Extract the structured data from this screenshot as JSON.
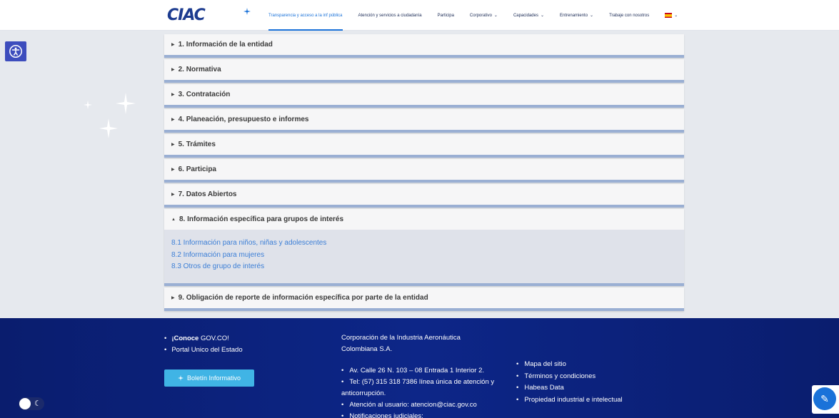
{
  "header": {
    "logo_text": "CIAC",
    "nav": [
      {
        "label": "Transparencia y acceso a la inf pública",
        "active": true,
        "dropdown": false
      },
      {
        "label": "Atención y servicios a ciudadanía",
        "active": false,
        "dropdown": false
      },
      {
        "label": "Participa",
        "active": false,
        "dropdown": false
      },
      {
        "label": "Corporativo",
        "active": false,
        "dropdown": true
      },
      {
        "label": "Capacidades",
        "active": false,
        "dropdown": true
      },
      {
        "label": "Entrenamiento",
        "active": false,
        "dropdown": true
      },
      {
        "label": "Trabaje con nosotros",
        "active": false,
        "dropdown": false
      }
    ],
    "language_icon": "spain-flag-icon"
  },
  "accordion": {
    "items": [
      {
        "label": "1. Información de la entidad"
      },
      {
        "label": "2. Normativa"
      },
      {
        "label": "3. Contratación"
      },
      {
        "label": "4. Planeación, presupuesto e informes"
      },
      {
        "label": "5. Trámites"
      },
      {
        "label": "6. Participa"
      },
      {
        "label": "7. Datos Abiertos"
      },
      {
        "label": "8. Información específica para grupos de interés"
      },
      {
        "label": "9. Obligación de reporte de información específica por parte de la entidad"
      }
    ],
    "expanded_links": [
      "8.1 Información para niños, niñas y adolescentes",
      "8.2 Información para mujeres",
      "8.3 Otros de grupo de interés"
    ]
  },
  "footer": {
    "col1": {
      "gov_bold": "¡Conoce",
      "gov_rest": " GOV.CO!",
      "portal": "Portal Unico del Estado",
      "boletin": "Boletín Informativo"
    },
    "col2": {
      "org_line1": "Corporación de la Industria Aeronáutica",
      "org_line2": "Colombiana S.A.",
      "address": "Av. Calle 26 N. 103 – 08 Entrada 1 Interior 2.",
      "phone": "Tel: (57) 315 318 7386 línea única de atención y anticorrupción.",
      "email": "Atención al usuario: atencion@ciac.gov.co",
      "judicial": "Notificaciones judiciales:"
    },
    "col3": [
      "Mapa del sitio",
      "Términos y condiciones",
      "Habeas Data",
      "Propiedad industrial e intelectual"
    ]
  },
  "colors": {
    "accent": "#1a72d9",
    "footer": "#0d2688",
    "accordion_border": "#9aafd3",
    "boletin": "#40b4e5"
  }
}
